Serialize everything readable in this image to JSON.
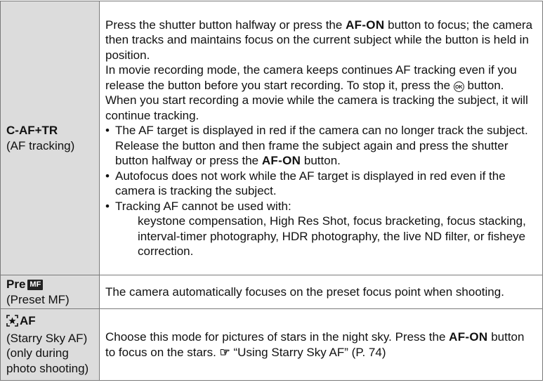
{
  "rows": [
    {
      "mode": "C-AF+TR",
      "sub": "(AF tracking)",
      "p1_a": "Press the shutter button halfway or press the ",
      "p1_key": "AF-ON",
      "p1_b": " button to focus; the camera then tracks and maintains focus on the current subject while the button is held in position.",
      "p2_a": "In movie recording mode, the camera keeps continues AF tracking even if you release the button before you start recording. To stop it, press the ",
      "p2_icon": "OK",
      "p2_b": " button.",
      "p3": "When you start recording a movie while the camera is tracking the subject, it will continue tracking.",
      "b1_a": "The AF target is displayed in red if the camera can no longer track the subject. Release the button and then frame the subject again and press the shutter button halfway or press the ",
      "b1_key": "AF-ON",
      "b1_b": " button.",
      "b2": "Autofocus does not work while the AF target is displayed in red even if the camera is tracking the subject.",
      "b3": "Tracking AF cannot be used with:",
      "b3_detail": "keystone compensation, High Res Shot, focus bracketing, focus stacking, interval-timer photography, HDR photography, the live ND filter, or fisheye correction."
    },
    {
      "mode": "Pre",
      "badge": "MF",
      "sub": "(Preset MF)",
      "desc": "The camera automatically focuses on the preset focus point when shooting."
    },
    {
      "mode": "AF",
      "sub": "(Starry Sky AF)",
      "sub2": "(only during photo shooting)",
      "desc_a": "Choose this mode for pictures of stars in the night sky. Press the ",
      "desc_key": "AF-ON",
      "desc_b": " button to focus on the stars. ",
      "ref_icon": "☞",
      "ref": "“Using Starry Sky AF” (P. 74)"
    }
  ]
}
